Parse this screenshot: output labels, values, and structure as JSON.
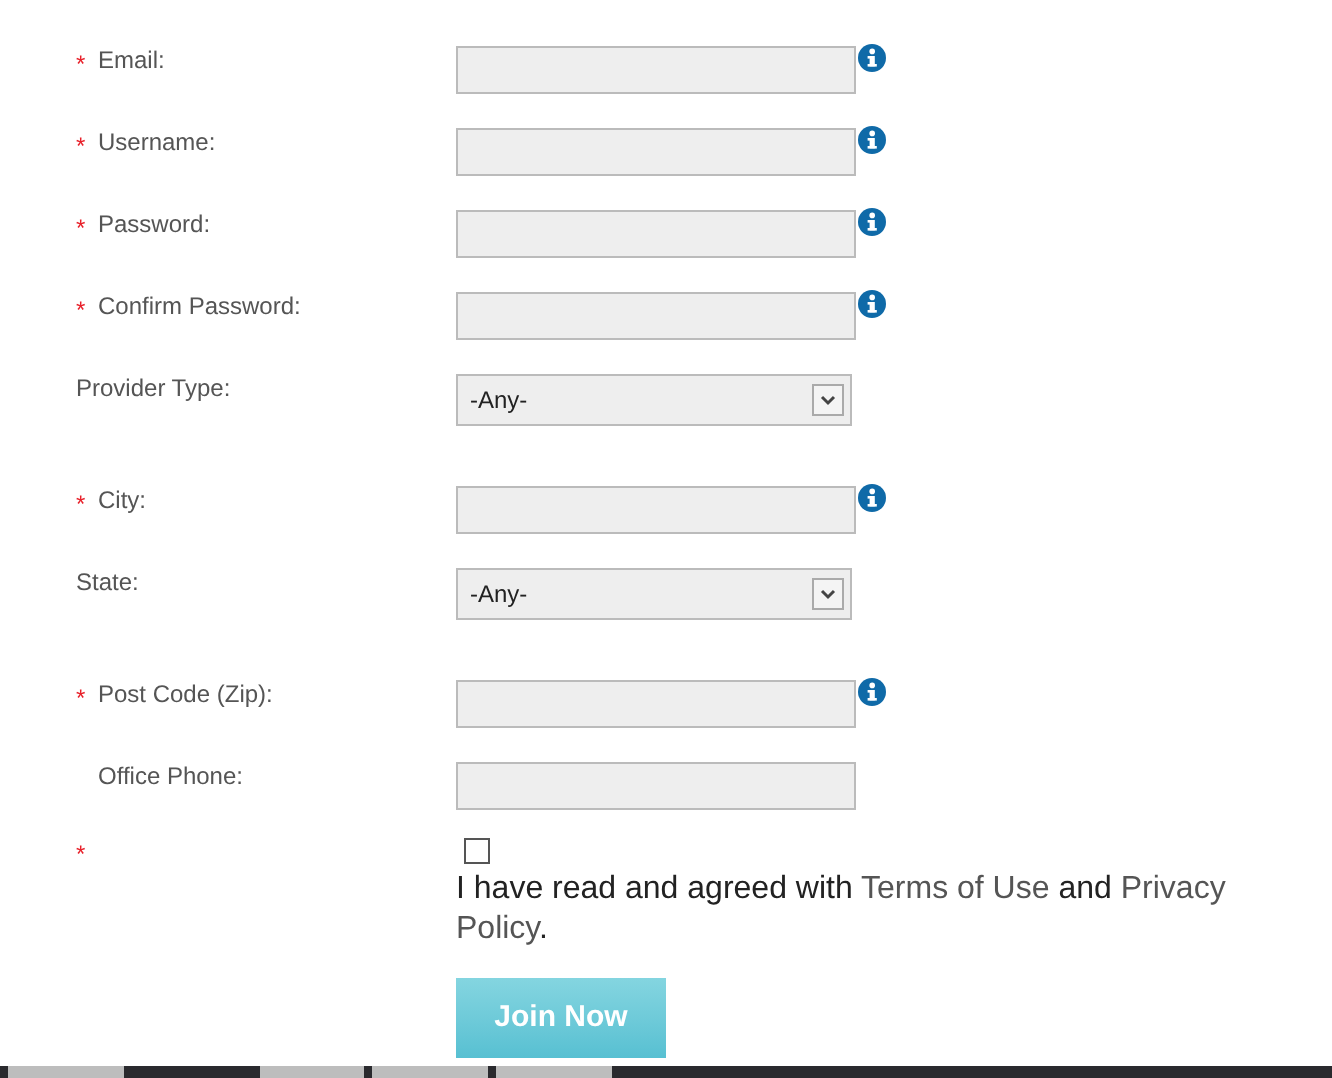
{
  "fields": [
    {
      "kind": "text",
      "label": "Email:",
      "mark": "*",
      "info": true
    },
    {
      "kind": "text",
      "label": "Username:",
      "mark": "*",
      "info": true
    },
    {
      "kind": "text",
      "label": "Password:",
      "mark": "*",
      "info": true
    },
    {
      "kind": "text",
      "label": "Confirm Password:",
      "mark": "*",
      "info": true
    },
    {
      "kind": "select",
      "label": "Provider Type:",
      "value": "-Any-"
    },
    {
      "kind": "text",
      "label": "City:",
      "mark": "*",
      "info": true
    },
    {
      "kind": "select",
      "label": "State:",
      "value": "-Any-"
    },
    {
      "kind": "text",
      "label": "Post Code (Zip):",
      "mark": "*",
      "info": true
    },
    {
      "kind": "text",
      "label": "Office Phone:",
      "info": false
    }
  ],
  "agreement": {
    "mark": "*",
    "checked": false,
    "before": "I have read and agreed with",
    "link1": "Terms of Use",
    "middle": "and",
    "link2_line1": "Privacy",
    "link2_line2": "Policy",
    "after": "."
  },
  "submit": "Join Now"
}
